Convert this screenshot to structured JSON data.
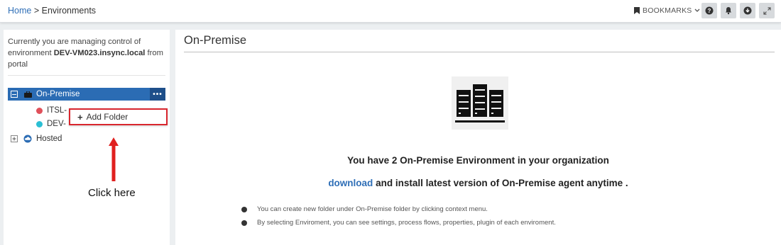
{
  "header": {
    "breadcrumb": {
      "home": "Home",
      "separator": ">",
      "current": "Environments"
    },
    "bookmarks_label": "BOOKMARKS",
    "icons": [
      "bookmark-icon",
      "help-icon",
      "bell-icon",
      "download-icon",
      "expand-icon"
    ]
  },
  "left_panel": {
    "manage_prefix": "Currently you are managing control of environment",
    "environment_name": "DEV-VM023.insync.local",
    "manage_suffix": "from portal",
    "tree": {
      "on_premise": {
        "label": "On-Premise",
        "more": "•••"
      },
      "children": [
        {
          "label": "ITSL-",
          "status_color": "#e0505a"
        },
        {
          "label": "DEV-",
          "status_color": "#2bbfd4"
        }
      ],
      "hosted": {
        "label": "Hosted",
        "icon": "cloud-icon"
      }
    },
    "context_menu": {
      "add_folder": "Add Folder"
    },
    "annotation": "Click here"
  },
  "main_panel": {
    "title": "On-Premise",
    "icon": "server-rack-icon",
    "summary": "You have 2 On-Premise Environment in your organization",
    "download_link": "download",
    "download_rest": "and install latest version of On-Premise agent anytime .",
    "bullets": [
      "You can create new folder under On-Premise folder by clicking context menu.",
      "By selecting Enviroment, you can see settings, process flows, properties, plugin of each enviroment."
    ]
  },
  "colors": {
    "accent": "#2b6cb4",
    "highlight_red": "#d9262e",
    "arrow_red": "#e0201f"
  }
}
